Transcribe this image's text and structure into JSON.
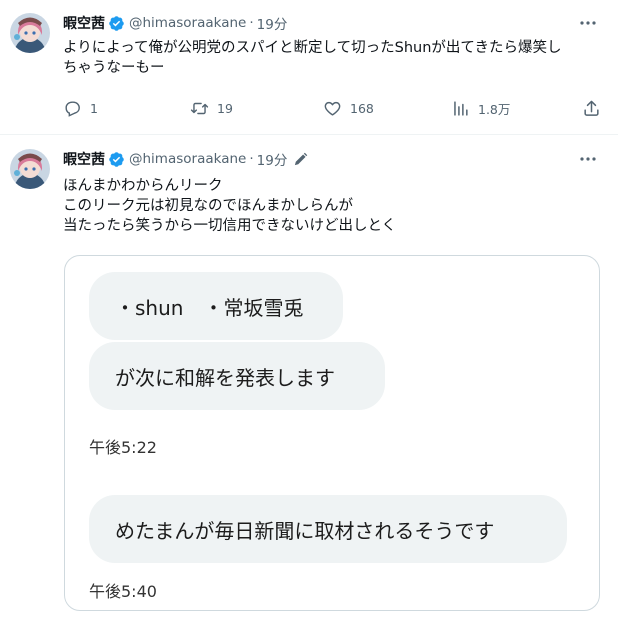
{
  "tweets": [
    {
      "display_name": "暇空茜",
      "handle": "@himasoraakane",
      "separator": "·",
      "time": "19分",
      "text_lines": [
        "よりによって俺が公明党のスパイと断定して切ったShunが出てきたら爆笑し",
        "ちゃうなーもー"
      ],
      "actions": {
        "replies": "1",
        "retweets": "19",
        "likes": "168",
        "views": "1.8万"
      }
    },
    {
      "display_name": "暇空茜",
      "handle": "@himasoraakane",
      "separator": "·",
      "time": "19分",
      "text_lines": [
        "ほんまかわからんリーク",
        "このリーク元は初見なのでほんまかしらんが",
        "当たったら笑うから一切信用できないけど出しとく"
      ],
      "media": {
        "bubbles": [
          "・shun　・常坂雪兎",
          "が次に和解を発表します",
          "めたまんが毎日新聞に取材されるそうです"
        ],
        "timestamps": [
          "午後5:22",
          "午後5:40"
        ]
      }
    }
  ],
  "icons": {
    "verified": "verified-badge-icon",
    "more": "more-options-icon",
    "reply": "reply-icon",
    "retweet": "retweet-icon",
    "like": "like-heart-icon",
    "views": "views-chart-icon",
    "share": "share-icon",
    "edit": "edited-pencil-icon"
  },
  "colors": {
    "verified_blue": "#1d9bf0",
    "secondary_text": "#536471",
    "divider": "#eff3f4",
    "bubble_bg": "#eff3f4"
  }
}
